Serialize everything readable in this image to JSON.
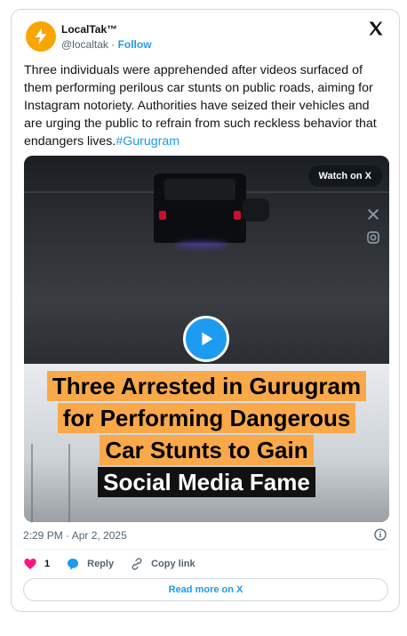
{
  "author": {
    "name": "LocalTak™",
    "handle": "@localtak",
    "separator": "·",
    "follow_label": "Follow"
  },
  "tweet": {
    "text": "Three individuals were apprehended after videos surfaced of them performing perilous car stunts on public roads, aiming for Instagram notoriety. Authorities have seized their vehicles and are urging the public to refrain from such reckless behavior that endangers lives.",
    "hashtag": "#Gurugram"
  },
  "media": {
    "watch_label": "Watch on X",
    "headline_lines": [
      "Three Arrested in Gurugram",
      "for Performing Dangerous",
      "Car Stunts to Gain",
      "Social Media Fame"
    ]
  },
  "meta": {
    "timestamp": "2:29 PM · Apr 2, 2025"
  },
  "actions": {
    "like_count": "1",
    "reply_label": "Reply",
    "copy_label": "Copy link"
  },
  "read_more_label": "Read more on X",
  "colors": {
    "accent": "#1d9bf0",
    "like": "#f91880",
    "headline_bg": "#f9a949"
  }
}
